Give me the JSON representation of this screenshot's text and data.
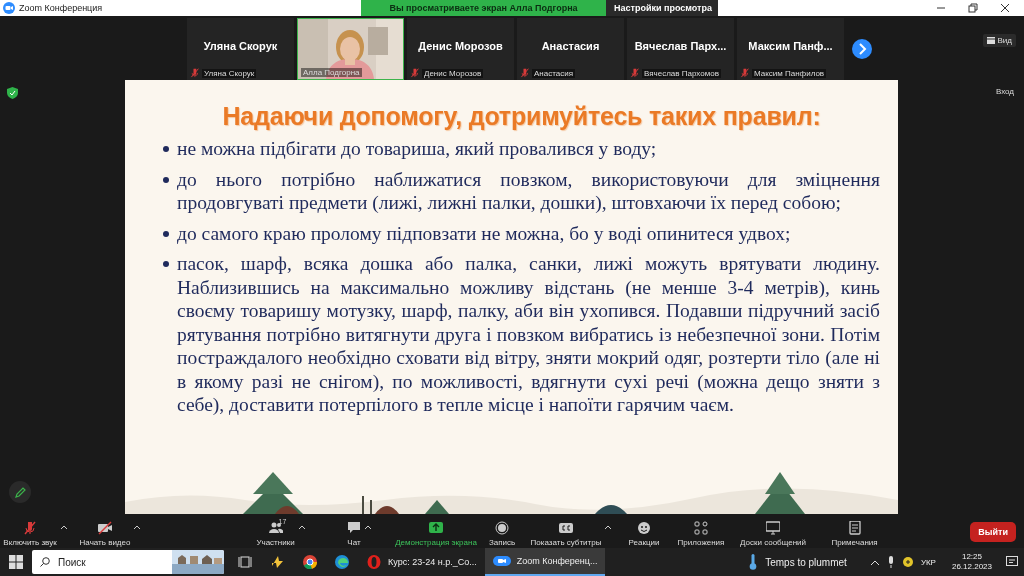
{
  "window": {
    "title": "Zoom Конференция"
  },
  "share_banner": {
    "text": "Вы просматриваете экран Алла Подгорна",
    "options_button": "Настройки просмотра"
  },
  "participants": [
    {
      "kind": "name",
      "name": "Уляна Скорук",
      "label": "Уляна Скорук",
      "muted": true,
      "speaking": false
    },
    {
      "kind": "video",
      "label": "Алла Подгорна",
      "muted": false,
      "speaking": true
    },
    {
      "kind": "name",
      "name": "Денис Морозов",
      "label": "Денис Морозов",
      "muted": true,
      "speaking": false
    },
    {
      "kind": "name",
      "name": "Анастасия",
      "label": "Анастасия",
      "muted": true,
      "speaking": false
    },
    {
      "kind": "name",
      "name": "Вячеслав  Парх...",
      "label": "Вячеслав Пархомов",
      "muted": true,
      "speaking": false
    },
    {
      "kind": "name",
      "name": "Максим  Панф...",
      "label": "Максим  Панфилов",
      "muted": true,
      "speaking": false
    }
  ],
  "view_button": "Вид",
  "side_label": "Вход",
  "slide": {
    "title": "Надаючи допомогу, дотримуйтесь таких правил:",
    "bullets": [
      "не можна підбігати до товариша, який провалився у воду;",
      "до нього потрібно наближатися повзком, використовуючи для зміцнення продовгуваті предмети (лижі, лижні палки, дошки), штовхаючи їх перед собою;",
      "до самого краю пролому підповзати не можна, бо у воді опинитеся удвох;",
      "пасок, шарф, всяка дошка або палка, санки, лижі можуть врятувати людину. Наблизившись на максимально можливу відстань (не менше 3-4 метрів), кинь своєму товаришу мотузку, шарф, палку, аби він ухопився. Подавши підручний засіб рятування потрібно витягнути друга і повзком вибратись із небезпечної зони. Потім постраждалого необхідно сховати від вітру, зняти мокрий одяг, розтерти тіло (але ні в якому разі не снігом), по можливості, вдягнути сухі речі (можна дещо зняти з себе), доставити потерпілого в тепле місце і напоїти гарячим чаєм."
    ]
  },
  "toolbar": [
    {
      "kind": "mic",
      "label": "Включить звук",
      "muted": true,
      "has_menu": true
    },
    {
      "kind": "video",
      "label": "Начать видео",
      "muted": true,
      "has_menu": true
    },
    {
      "kind": "participants",
      "label": "Участники",
      "count": "17",
      "has_menu": true
    },
    {
      "kind": "chat",
      "label": "Чат",
      "has_menu": true
    },
    {
      "kind": "share",
      "label": "Демонстрация экрана",
      "has_menu": false
    },
    {
      "kind": "record",
      "label": "Запись",
      "has_menu": false
    },
    {
      "kind": "captions",
      "label": "Показать субтитры",
      "has_menu": true
    },
    {
      "kind": "reactions",
      "label": "Реакции",
      "has_menu": false
    },
    {
      "kind": "apps",
      "label": "Приложения",
      "has_menu": false
    },
    {
      "kind": "whiteboard",
      "label": "Доски сообщений",
      "has_menu": false
    },
    {
      "kind": "notes",
      "label": "Примечания",
      "has_menu": false
    }
  ],
  "leave_button": "Выйти",
  "taskbar": {
    "search_placeholder": "Поиск",
    "apps": [
      {
        "kind": "taskview",
        "selected": false
      },
      {
        "kind": "files",
        "selected": false
      },
      {
        "kind": "chrome",
        "selected": false
      },
      {
        "kind": "edge",
        "selected": false
      },
      {
        "kind": "opera",
        "label": "Курс: 23-24 н.р._Со...",
        "selected": false
      },
      {
        "kind": "zoom",
        "label": "Zoom Конференц...",
        "selected": true
      }
    ],
    "weather": "Temps to plummet",
    "language": "УКР",
    "time": "12:25",
    "date": "26.12.2023"
  }
}
